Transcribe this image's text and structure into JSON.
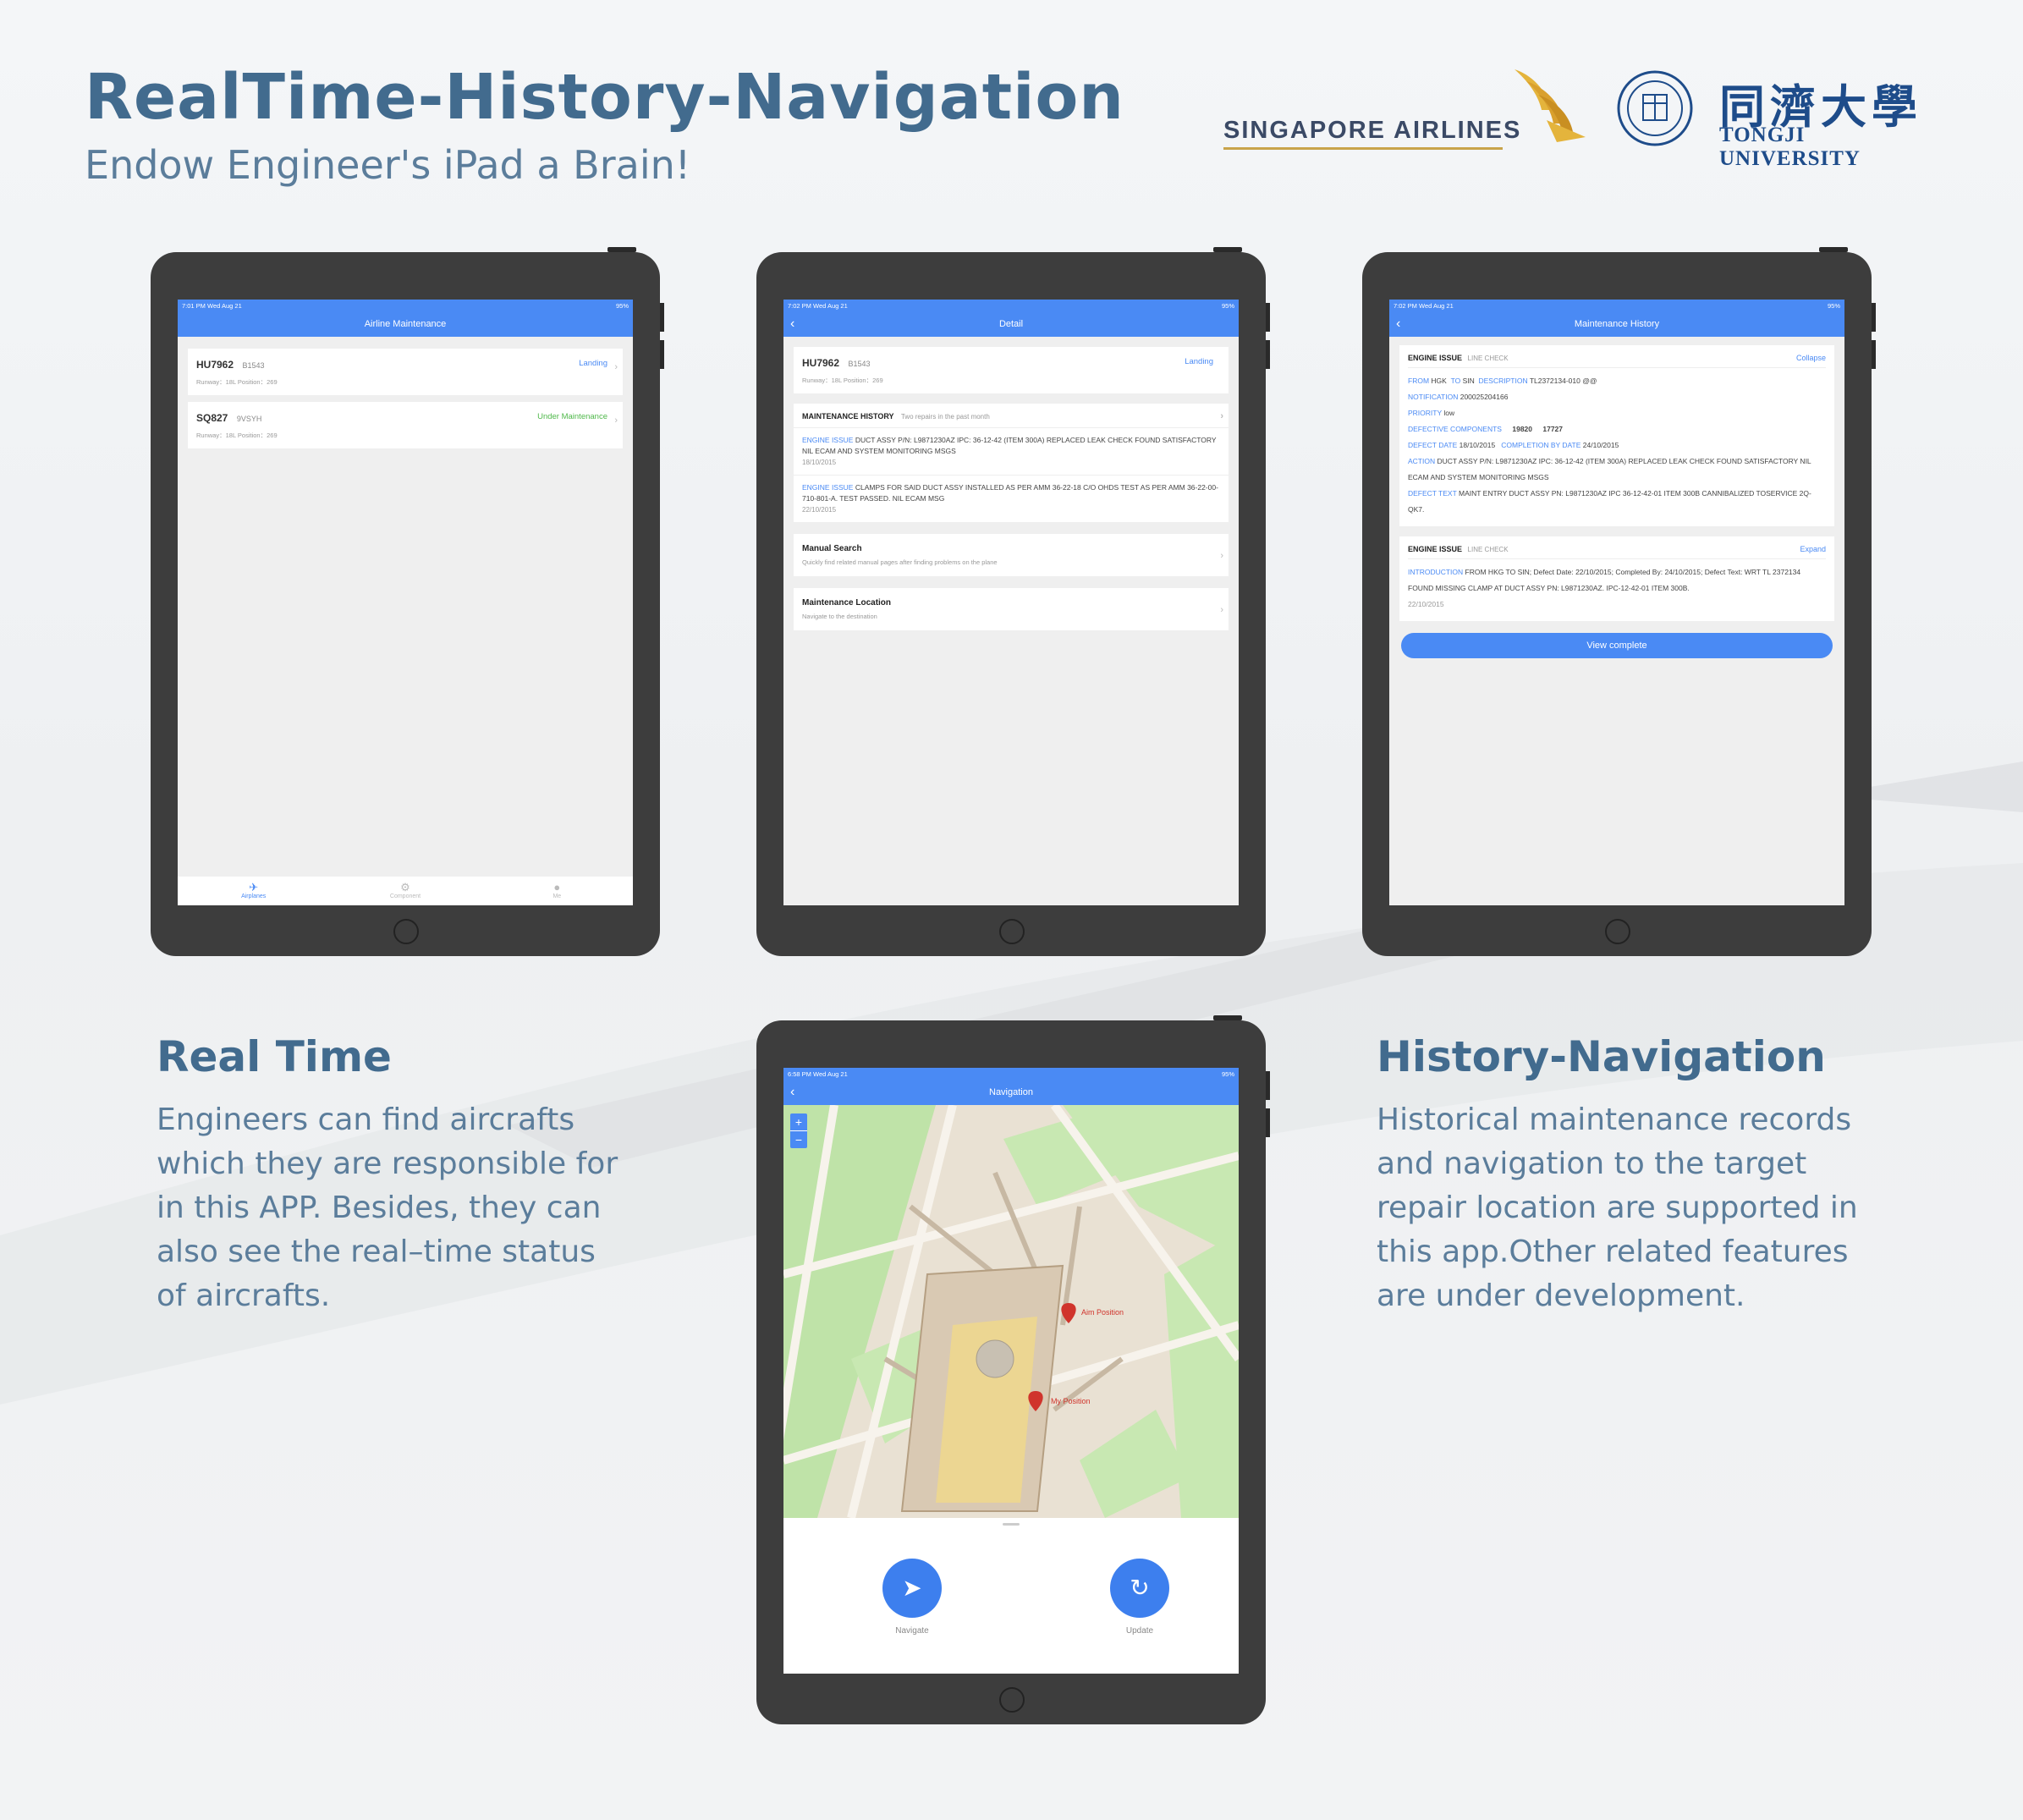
{
  "hero": {
    "title": "RealTime-History-Navigation",
    "subtitle": "Endow Engineer's iPad a Brain!"
  },
  "logos": {
    "sia": "SINGAPORE AIRLINES",
    "tongji_cn": "同濟大學",
    "tongji_en": "TONGJI UNIVERSITY"
  },
  "sections": {
    "realtime": {
      "title": "Real Time",
      "body": "Engineers can find aircrafts which they are responsible for in this APP. Besides, they can also see the real–time status of aircrafts."
    },
    "history": {
      "title": "History-Navigation",
      "body": "Historical maintenance records and navigation to the target repair location are supported in this app.Other related features are under development."
    }
  },
  "screen1": {
    "time": "7:01 PM   Wed Aug 21",
    "battery": "95%",
    "title": "Airline Maintenance",
    "flights": [
      {
        "id": "HU7962",
        "reg": "B1543",
        "meta": "Runway：18L   Position：269",
        "status": "Landing"
      },
      {
        "id": "SQ827",
        "reg": "9VSYH",
        "meta": "Runway：18L   Position：269",
        "status": "Under Maintenance"
      }
    ],
    "tabs": [
      "Airplanes",
      "Component",
      "Me"
    ]
  },
  "screen2": {
    "time": "7:02 PM   Wed Aug 21",
    "battery": "95%",
    "title": "Detail",
    "flight": {
      "id": "HU7962",
      "reg": "B1543",
      "meta": "Runway：18L   Position：269",
      "status": "Landing"
    },
    "history_title": "MAINTENANCE HISTORY",
    "history_sub": "Two repairs in the past month",
    "history": [
      {
        "tag": "ENGINE ISSUE",
        "text": "DUCT ASSY P/N: L9871230AZ IPC: 36-12-42 (ITEM 300A) REPLACED LEAK CHECK FOUND SATISFACTORY NIL ECAM AND SYSTEM MONITORING MSGS",
        "date": "18/10/2015"
      },
      {
        "tag": "ENGINE ISSUE",
        "text": "CLAMPS FOR SAID DUCT ASSY INSTALLED AS PER AMM 36-22-18 C/O OHDS TEST AS PER AMM 36-22-00-710-801-A. TEST PASSED. NIL ECAM MSG",
        "date": "22/10/2015"
      }
    ],
    "menu": [
      {
        "title": "Manual Search",
        "desc": "Quickly find related manual pages after finding problems on the plane"
      },
      {
        "title": "Maintenance Location",
        "desc": "Navigate to the destination"
      }
    ]
  },
  "screen3": {
    "time": "7:02 PM   Wed Aug 21",
    "battery": "95%",
    "title": "Maintenance History",
    "rec1": {
      "head": "ENGINE ISSUE",
      "sub": "LINE CHECK",
      "action": "Collapse",
      "from_label": "FROM",
      "from": "HGK",
      "to_label": "TO",
      "to": "SIN",
      "desc_label": "DESCRIPTION",
      "desc": "TL2372134-010 @@",
      "notif_label": "NOTIFICATION",
      "notif": "200025204166",
      "prio_label": "PRIORITY",
      "prio": "low",
      "defc_label": "DEFECTIVE COMPONENTS",
      "defc1": "19820",
      "defc2": "17727",
      "ddate_label": "DEFECT DATE",
      "ddate": "18/10/2015",
      "cdate_label": "COMPLETION BY DATE",
      "cdate": "24/10/2015",
      "action_label": "ACTION",
      "action_text": "DUCT ASSY P/N: L9871230AZ IPC: 36-12-42 (ITEM 300A) REPLACED LEAK CHECK FOUND SATISFACTORY NIL ECAM AND SYSTEM MONITORING MSGS",
      "dtext_label": "DEFECT TEXT",
      "dtext": "MAINT ENTRY DUCT ASSY PN: L9871230AZ IPC 36-12-42-01 ITEM 300B CANNIBALIZED TOSERVICE 2Q-QK7."
    },
    "rec2": {
      "head": "ENGINE ISSUE",
      "sub": "LINE CHECK",
      "action": "Expand",
      "intro_label": "INTRODUCTION",
      "intro": "FROM HKG TO SIN; Defect Date: 22/10/2015; Completed By: 24/10/2015; Defect Text: WRT TL 2372134 FOUND MISSING CLAMP AT DUCT ASSY PN: L9871230AZ. IPC-12-42-01 ITEM 300B.",
      "date": "22/10/2015"
    },
    "button": "View complete"
  },
  "screen4": {
    "time": "6:58 PM   Wed Aug 21",
    "battery": "95%",
    "title": "Navigation",
    "aim": "Aim Position",
    "mine": "My Position",
    "navigate": "Navigate",
    "update": "Update",
    "zoom_in": "+",
    "zoom_out": "−"
  },
  "colors": {
    "accent": "#4a8af4",
    "heading": "#426b8e",
    "body_text": "#5b7d9b",
    "status_green": "#4fb84a",
    "pin": "#d0342c"
  },
  "icons": [
    "airplane-icon",
    "component-icon",
    "person-icon",
    "back-chevron-icon",
    "navigate-arrow-icon",
    "refresh-icon",
    "map-pin-icon"
  ]
}
